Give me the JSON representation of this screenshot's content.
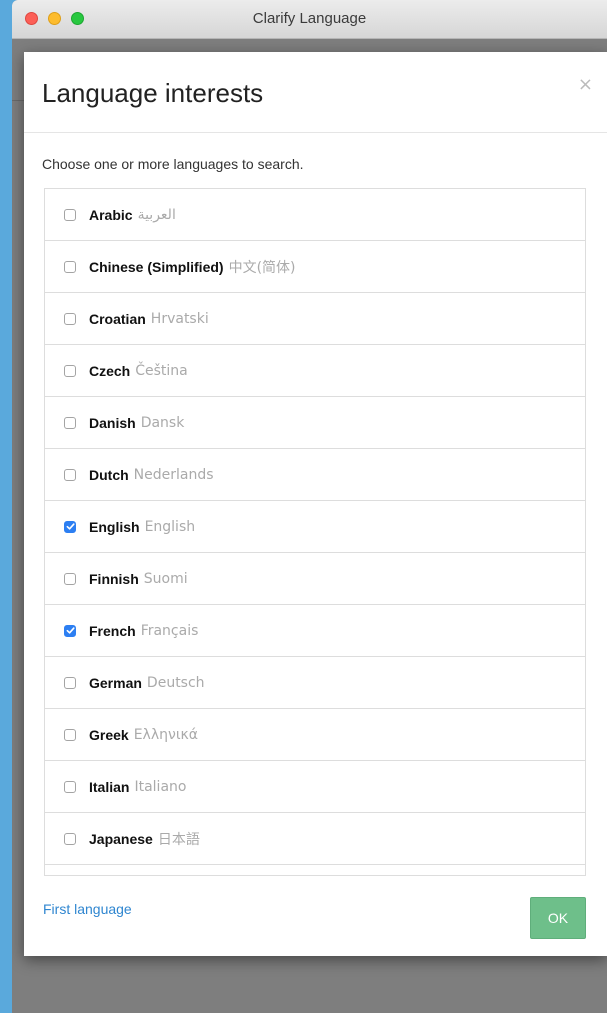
{
  "window": {
    "title": "Clarify Language"
  },
  "modal": {
    "title": "Language interests",
    "close_label": "×",
    "instructions": "Choose one or more languages to search.",
    "languages": [
      {
        "name": "Arabic",
        "native": "العربية",
        "checked": false
      },
      {
        "name": "Chinese (Simplified)",
        "native": "中文(简体)",
        "checked": false
      },
      {
        "name": "Croatian",
        "native": "Hrvatski",
        "checked": false
      },
      {
        "name": "Czech",
        "native": "Čeština",
        "checked": false
      },
      {
        "name": "Danish",
        "native": "Dansk",
        "checked": false
      },
      {
        "name": "Dutch",
        "native": "Nederlands",
        "checked": false
      },
      {
        "name": "English",
        "native": "English",
        "checked": true
      },
      {
        "name": "Finnish",
        "native": "Suomi",
        "checked": false
      },
      {
        "name": "French",
        "native": "Français",
        "checked": true
      },
      {
        "name": "German",
        "native": "Deutsch",
        "checked": false
      },
      {
        "name": "Greek",
        "native": "Ελληνικά",
        "checked": false
      },
      {
        "name": "Italian",
        "native": "Italiano",
        "checked": false
      },
      {
        "name": "Japanese",
        "native": "日本語",
        "checked": false
      },
      {
        "name": "",
        "native": "",
        "checked": false
      }
    ],
    "footer": {
      "first_language_link": "First language",
      "ok_label": "OK"
    }
  },
  "colors": {
    "desktop": "#5aa9dc",
    "checkbox_checked": "#2d7ff2",
    "ok_button": "#6ebf8a",
    "link": "#2f86d0"
  }
}
